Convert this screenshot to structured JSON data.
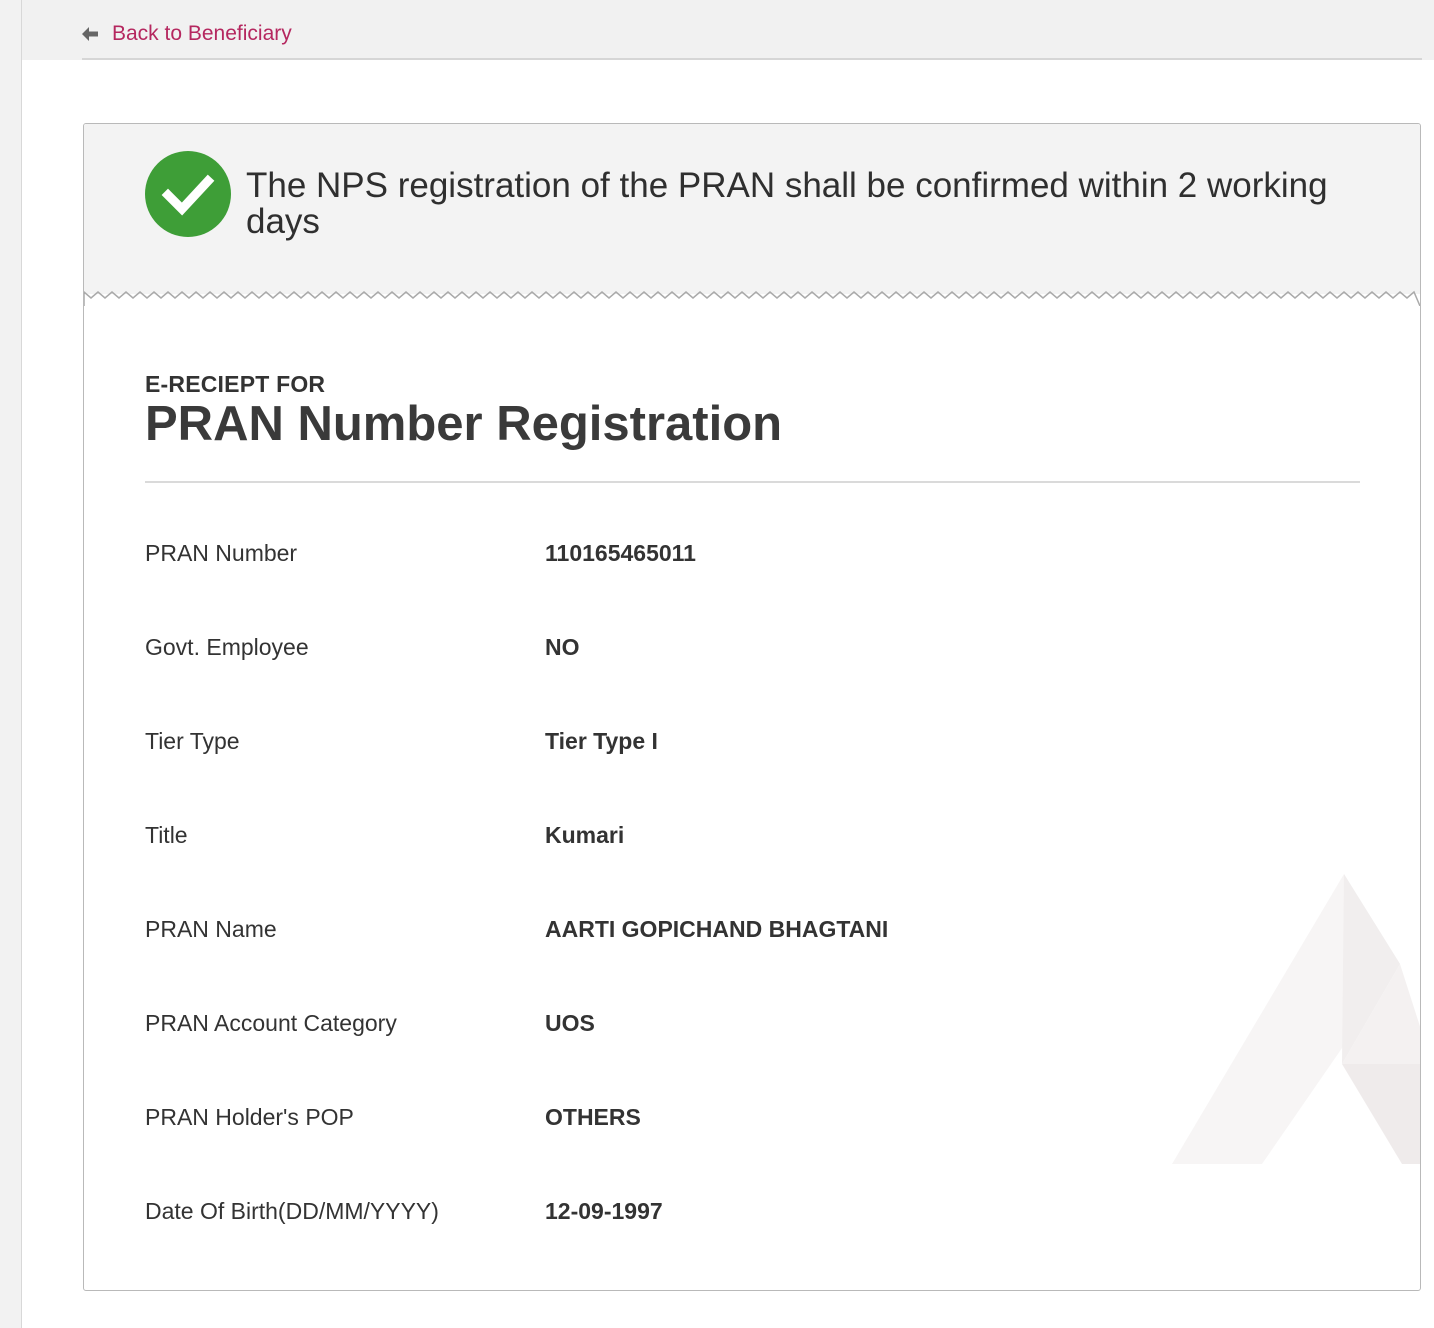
{
  "nav": {
    "back_label": "Back to Beneficiary"
  },
  "banner": {
    "message": "The NPS registration of the PRAN shall be confirmed within 2 working days",
    "status_color": "#3e9e37"
  },
  "receipt": {
    "subheading": "E-RECIEPT FOR",
    "title": "PRAN Number Registration",
    "fields": [
      {
        "label": "PRAN Number",
        "value": "110165465011"
      },
      {
        "label": "Govt. Employee",
        "value": "NO"
      },
      {
        "label": "Tier Type",
        "value": "Tier Type I"
      },
      {
        "label": "Title",
        "value": "Kumari"
      },
      {
        "label": "PRAN Name",
        "value": "AARTI GOPICHAND BHAGTANI"
      },
      {
        "label": "PRAN Account Category",
        "value": "UOS"
      },
      {
        "label": "PRAN Holder's POP",
        "value": "OTHERS"
      },
      {
        "label": "Date Of Birth(DD/MM/YYYY)",
        "value": "12-09-1997"
      }
    ]
  },
  "colors": {
    "link": "#b5275f",
    "success": "#3e9e37"
  }
}
